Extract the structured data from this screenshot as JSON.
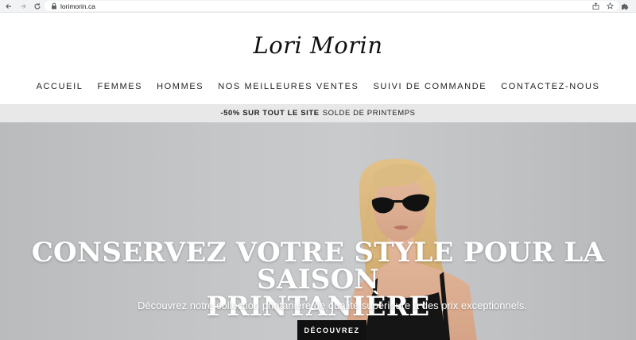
{
  "browser": {
    "url": "lorimorin.ca",
    "icons": [
      "back-arrow-icon",
      "forward-arrow-icon",
      "reload-icon",
      "lock-icon",
      "share-icon",
      "star-icon",
      "extensions-icon"
    ]
  },
  "header": {
    "logo": "Lori Morin",
    "nav": [
      {
        "label": "ACCUEIL"
      },
      {
        "label": "FEMMES"
      },
      {
        "label": "HOMMES"
      },
      {
        "label": "NOS MEILLEURES VENTES"
      },
      {
        "label": "SUIVI DE COMMANDE"
      },
      {
        "label": "CONTACTEZ-NOUS"
      }
    ]
  },
  "announcement": {
    "highlight": "-50% SUR TOUT LE SITE",
    "text": "SOLDE DE PRINTEMPS"
  },
  "hero": {
    "title_line1": "CONSERVEZ VOTRE STYLE POUR LA SAISON",
    "title_line2": "PRINTANIÈRE",
    "subtitle": "Découvrez notre collection printanière de qualité supérieure à des prix exceptionnels.",
    "button": "DÉCOUVREZ"
  },
  "colors": {
    "announcement_bg": "#e8e8e8",
    "hero_bg": "#c4c6c8",
    "button_bg": "#111111",
    "hair": "#d9b679"
  }
}
